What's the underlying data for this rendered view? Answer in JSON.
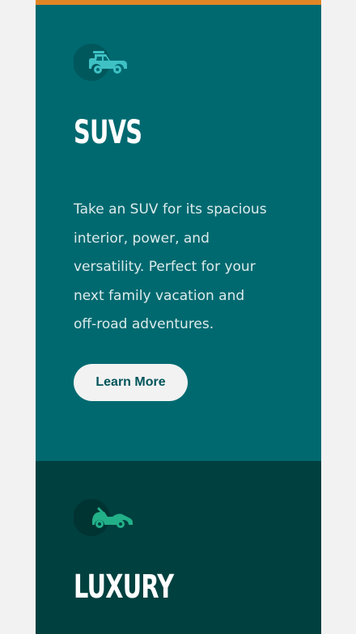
{
  "colors": {
    "page_background": "#f2f2f2",
    "accent_bar": "#e28625",
    "suvs_card": "#006970",
    "luxury_card": "#00403f",
    "suv_icon": "#3fc1c4",
    "luxury_icon": "#22b089",
    "button_background": "#f2f2f2",
    "button_text": "#00545a"
  },
  "cards": [
    {
      "id": "suvs",
      "icon": "suv-car-icon",
      "title": "SUVS",
      "description": "Take an SUV for its spacious interior, power, and versatility. Perfect for your next family vacation and off-road adventures.",
      "button_label": "Learn More"
    },
    {
      "id": "luxury",
      "icon": "convertible-car-icon",
      "title": "LUXURY"
    }
  ]
}
